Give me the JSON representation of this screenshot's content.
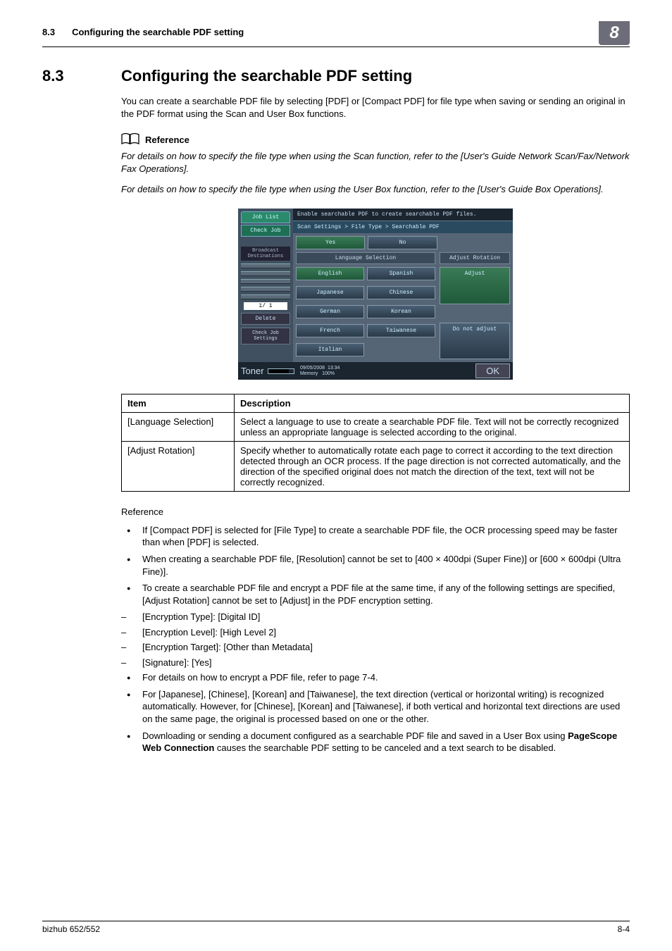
{
  "header": {
    "section_number": "8.3",
    "running_title": "Configuring the searchable PDF setting",
    "chapter_tab": "8"
  },
  "section_title": "Configuring the searchable PDF setting",
  "intro": "You can create a searchable PDF file by selecting [PDF] or [Compact PDF] for file type when saving or sending an original in the PDF format using the Scan and User Box functions.",
  "reference_heading": "Reference",
  "reference_p1": "For details on how to specify the file type when using the Scan function, refer to the [User's Guide Network Scan/Fax/Network Fax Operations].",
  "reference_p2": "For details on how to specify the file type when using the User Box function, refer to the [User's Guide Box Operations].",
  "screenshot": {
    "left": {
      "tab1": "Job List",
      "tab2": "Check Job",
      "broadcast": "Broadcast\nDestinations",
      "pager": "1/  1",
      "delete": "Delete",
      "check": "Check Job\nSettings",
      "toner": "Toner"
    },
    "right": {
      "title": "Enable searchable PDF to create searchable PDF files.",
      "crumb": "Scan Settings > File Type > Searchable PDF",
      "yes": "Yes",
      "no": "No",
      "lang_hdr": "Language Selection",
      "rot_hdr": "Adjust Rotation",
      "langs": [
        "English",
        "Spanish",
        "Japanese",
        "Chinese",
        "German",
        "Korean",
        "French",
        "Taiwanese",
        "Italian"
      ],
      "adjust": "Adjust",
      "noadjust": "Do not adjust",
      "date": "09/05/2008",
      "time": "13:34",
      "mem": "Memory",
      "mempct": "100%",
      "ok": "OK"
    }
  },
  "table": {
    "h1": "Item",
    "h2": "Description",
    "rows": [
      {
        "item": "[Language Selection]",
        "desc": "Select a language to use to create a searchable PDF file.\nText will not be correctly recognized unless an appropriate language is selected according to the original."
      },
      {
        "item": "[Adjust Rotation]",
        "desc": "Specify whether to automatically rotate each page to correct it according to the text direction detected through an OCR process.\nIf the page direction is not corrected automatically, and the direction of the specified original does not match the direction of the text, text will not be correctly recognized."
      }
    ]
  },
  "ref_word": "Reference",
  "bullets_a": [
    "If [Compact PDF] is selected for [File Type] to create a searchable PDF file, the OCR processing speed may be faster than when [PDF] is selected.",
    "When creating a searchable PDF file, [Resolution] cannot be set to [400 × 400dpi (Super Fine)] or [600 × 600dpi (Ultra Fine)].",
    "To create a searchable PDF file and encrypt a PDF file at the same time, if any of the following settings are specified, [Adjust Rotation] cannot be set to [Adjust] in the PDF encryption setting."
  ],
  "dashes": [
    "[Encryption Type]: [Digital ID]",
    "[Encryption Level]: [High Level 2]",
    "[Encryption Target]: [Other than Metadata]",
    "[Signature]: [Yes]"
  ],
  "bullets_b": [
    "For details on how to encrypt a PDF file, refer to page 7-4.",
    "For [Japanese], [Chinese], [Korean] and [Taiwanese], the text direction (vertical or horizontal writing) is recognized automatically. However, for [Chinese], [Korean] and [Taiwanese], if both vertical and horizontal text directions are used on the same page, the original is processed based on one or the other."
  ],
  "bullet_c_pre": "Downloading or sending a document configured as a searchable PDF file and saved in a User Box using ",
  "bullet_c_bold": "PageScope Web Connection",
  "bullet_c_post": " causes the searchable PDF setting to be canceled and a text search to be disabled.",
  "footer": {
    "left": "bizhub 652/552",
    "right": "8-4"
  }
}
